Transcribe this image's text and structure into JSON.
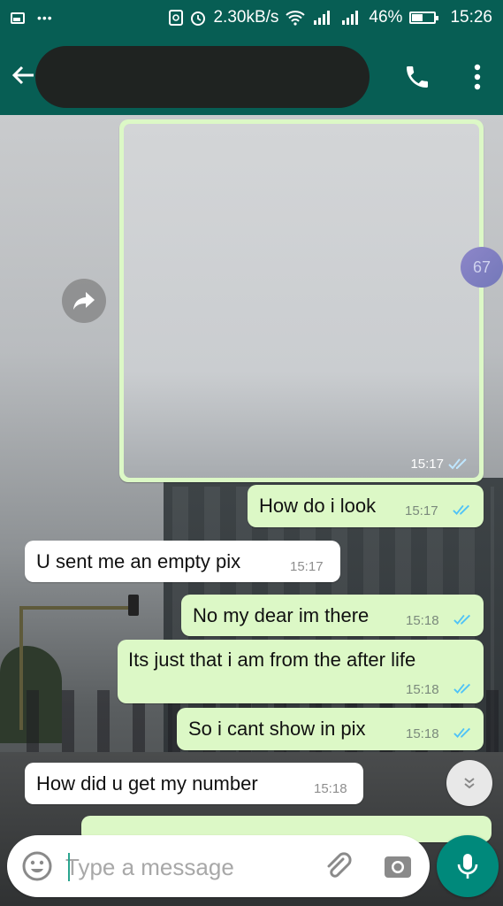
{
  "status_bar": {
    "speed": "2.30kB/s",
    "battery": "46%",
    "time": "15:26"
  },
  "header": {
    "contact_name": ""
  },
  "messages": [
    {
      "type": "image",
      "direction": "out",
      "time": "15:17",
      "status": "read"
    },
    {
      "type": "text",
      "direction": "out",
      "text": "How do i look",
      "time": "15:17",
      "status": "read"
    },
    {
      "type": "text",
      "direction": "in",
      "text": "U sent me an empty pix",
      "time": "15:17"
    },
    {
      "type": "text",
      "direction": "out",
      "text": "No my dear im there",
      "time": "15:18",
      "status": "read"
    },
    {
      "type": "text",
      "direction": "out",
      "text": "Its just that i am from the after life",
      "time": "15:18",
      "status": "read"
    },
    {
      "type": "text",
      "direction": "out",
      "text": "So i cant show in pix",
      "time": "15:18",
      "status": "read"
    },
    {
      "type": "text",
      "direction": "in",
      "text": "How did u get my number",
      "time": "15:18"
    }
  ],
  "unread_count": "67",
  "composer": {
    "placeholder": "Type a message"
  },
  "colors": {
    "header": "#075e54",
    "outgoing_bubble": "#dcf8c6",
    "incoming_bubble": "#ffffff",
    "read_ticks": "#4fc3f7",
    "mic_button": "#00897b"
  },
  "icons": [
    "gallery-icon",
    "wifi-icon",
    "signal-icon",
    "battery-icon",
    "back-arrow-icon",
    "phone-icon",
    "more-vert-icon",
    "forward-icon",
    "double-check-icon",
    "chevron-down-icon",
    "emoji-icon",
    "attach-icon",
    "camera-icon",
    "mic-icon"
  ]
}
